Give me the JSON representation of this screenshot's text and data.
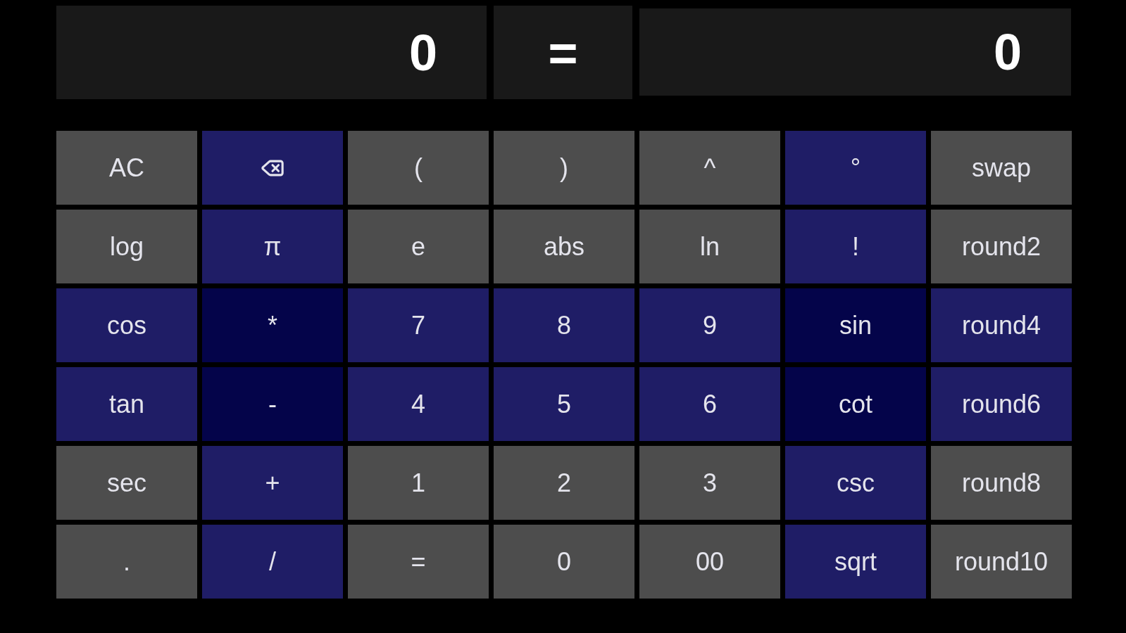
{
  "displays": {
    "expression": {
      "value": "0"
    },
    "equals": "=",
    "result": {
      "value": "0"
    }
  },
  "keys": [
    {
      "kind": "label",
      "label": "AC",
      "color": "#4d4d4d"
    },
    {
      "kind": "backspace",
      "color": "#1f1d66"
    },
    {
      "kind": "label",
      "label": "(",
      "color": "#4d4d4d"
    },
    {
      "kind": "label",
      "label": ")",
      "color": "#4d4d4d"
    },
    {
      "kind": "label",
      "label": "^",
      "color": "#4d4d4d"
    },
    {
      "kind": "label",
      "label": "°",
      "color": "#1f1d66"
    },
    {
      "kind": "label",
      "label": "swap",
      "color": "#4d4d4d"
    },
    {
      "kind": "label",
      "label": "log",
      "color": "#4d4d4d"
    },
    {
      "kind": "label",
      "label": "π",
      "color": "#1f1d66"
    },
    {
      "kind": "label",
      "label": "e",
      "color": "#4d4d4d"
    },
    {
      "kind": "label",
      "label": "abs",
      "color": "#4d4d4d"
    },
    {
      "kind": "label",
      "label": "ln",
      "color": "#4d4d4d"
    },
    {
      "kind": "label",
      "label": "!",
      "color": "#1f1d66"
    },
    {
      "kind": "label",
      "label": "round2",
      "color": "#4d4d4d"
    },
    {
      "kind": "label",
      "label": "cos",
      "color": "#1f1d66"
    },
    {
      "kind": "label",
      "label": "*",
      "color": "#04044a"
    },
    {
      "kind": "label",
      "label": "7",
      "color": "#1f1d66"
    },
    {
      "kind": "label",
      "label": "8",
      "color": "#1f1d66"
    },
    {
      "kind": "label",
      "label": "9",
      "color": "#1f1d66"
    },
    {
      "kind": "label",
      "label": "sin",
      "color": "#04044a"
    },
    {
      "kind": "label",
      "label": "round4",
      "color": "#1f1d66"
    },
    {
      "kind": "label",
      "label": "tan",
      "color": "#1f1d66"
    },
    {
      "kind": "label",
      "label": "-",
      "color": "#04044a"
    },
    {
      "kind": "label",
      "label": "4",
      "color": "#1f1d66"
    },
    {
      "kind": "label",
      "label": "5",
      "color": "#1f1d66"
    },
    {
      "kind": "label",
      "label": "6",
      "color": "#1f1d66"
    },
    {
      "kind": "label",
      "label": "cot",
      "color": "#04044a"
    },
    {
      "kind": "label",
      "label": "round6",
      "color": "#1f1d66"
    },
    {
      "kind": "label",
      "label": "sec",
      "color": "#4d4d4d"
    },
    {
      "kind": "label",
      "label": "+",
      "color": "#1f1d66"
    },
    {
      "kind": "label",
      "label": "1",
      "color": "#4d4d4d"
    },
    {
      "kind": "label",
      "label": "2",
      "color": "#4d4d4d"
    },
    {
      "kind": "label",
      "label": "3",
      "color": "#4d4d4d"
    },
    {
      "kind": "label",
      "label": "csc",
      "color": "#1f1d66"
    },
    {
      "kind": "label",
      "label": "round8",
      "color": "#4d4d4d"
    },
    {
      "kind": "label",
      "label": ".",
      "color": "#4d4d4d"
    },
    {
      "kind": "label",
      "label": "/",
      "color": "#1f1d66"
    },
    {
      "kind": "label",
      "label": "=",
      "color": "#4d4d4d"
    },
    {
      "kind": "label",
      "label": "0",
      "color": "#4d4d4d"
    },
    {
      "kind": "label",
      "label": "00",
      "color": "#4d4d4d"
    },
    {
      "kind": "label",
      "label": "sqrt",
      "color": "#1f1d66"
    },
    {
      "kind": "label",
      "label": "round10",
      "color": "#4d4d4d"
    }
  ]
}
